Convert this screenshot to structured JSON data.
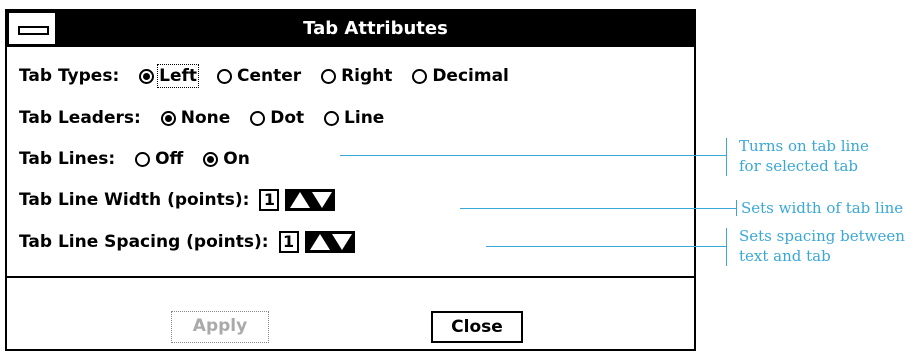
{
  "dialog": {
    "title": "Tab Attributes",
    "tab_types": {
      "label": "Tab Types:",
      "options": [
        "Left",
        "Center",
        "Right",
        "Decimal"
      ],
      "selected": "Left"
    },
    "tab_leaders": {
      "label": "Tab Leaders:",
      "options": [
        "None",
        "Dot",
        "Line"
      ],
      "selected": "None"
    },
    "tab_lines": {
      "label": "Tab Lines:",
      "options": [
        "Off",
        "On"
      ],
      "selected": "On"
    },
    "line_width": {
      "label": "Tab Line Width (points):",
      "value": "1"
    },
    "line_spacing": {
      "label": "Tab Line Spacing (points):",
      "value": "1"
    },
    "buttons": {
      "apply": "Apply",
      "close": "Close"
    }
  },
  "callouts": {
    "tab_lines_1": "Turns on tab line",
    "tab_lines_2": "for selected tab",
    "width": "Sets width of tab line",
    "spacing_1": "Sets spacing between",
    "spacing_2": "text and tab"
  },
  "colors": {
    "callout": "#39a8d6",
    "titlebar": "#000000"
  }
}
